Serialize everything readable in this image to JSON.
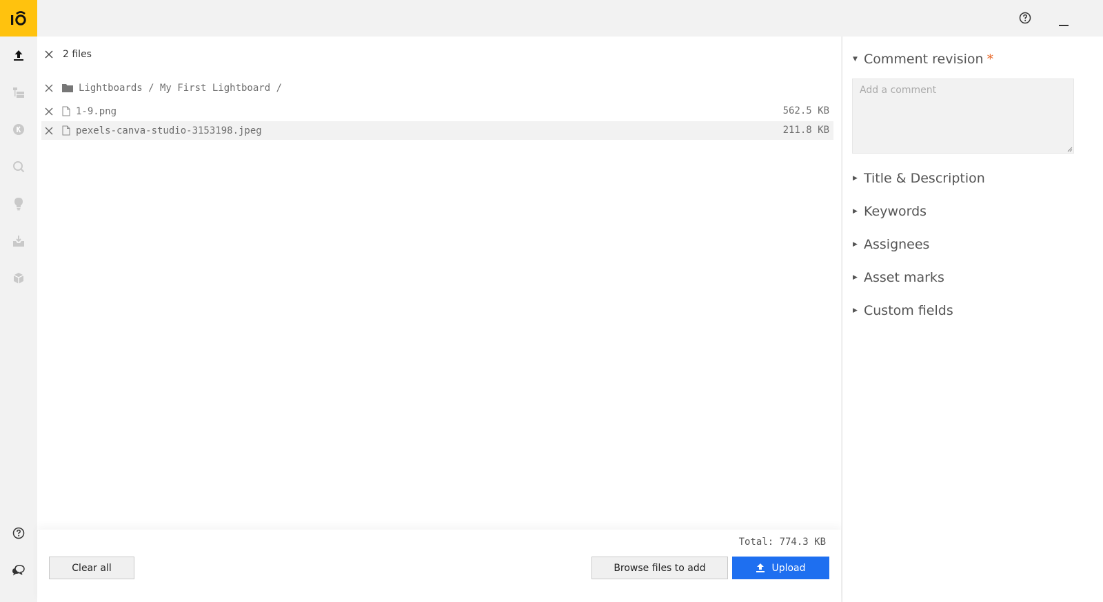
{
  "files_header": {
    "count_label": "2 files"
  },
  "folder": {
    "path": "Lightboards / My First Lightboard /"
  },
  "files": [
    {
      "name": "1-9.png",
      "size": "562.5 KB"
    },
    {
      "name": "pexels-canva-studio-3153198.jpeg",
      "size": "211.8 KB"
    }
  ],
  "footer": {
    "total": "Total: 774.3 KB",
    "clear_label": "Clear all",
    "browse_label": "Browse files to add",
    "upload_label": "Upload"
  },
  "right_panel": {
    "comment_title": "Comment revision",
    "required_mark": "*",
    "comment_placeholder": "Add a comment",
    "sections": [
      "Title & Description",
      "Keywords",
      "Assignees",
      "Asset marks",
      "Custom fields"
    ]
  },
  "icons": {
    "logo": "io-logo",
    "rail": [
      "upload-icon",
      "folder-tree-icon",
      "k-circle-icon",
      "search-icon",
      "lightbulb-icon",
      "download-tray-icon",
      "box-icon",
      "help-icon",
      "chat-icon"
    ]
  },
  "colors": {
    "brand": "#ffc20e",
    "primary": "#1e6ff0",
    "required": "#e8692a"
  }
}
